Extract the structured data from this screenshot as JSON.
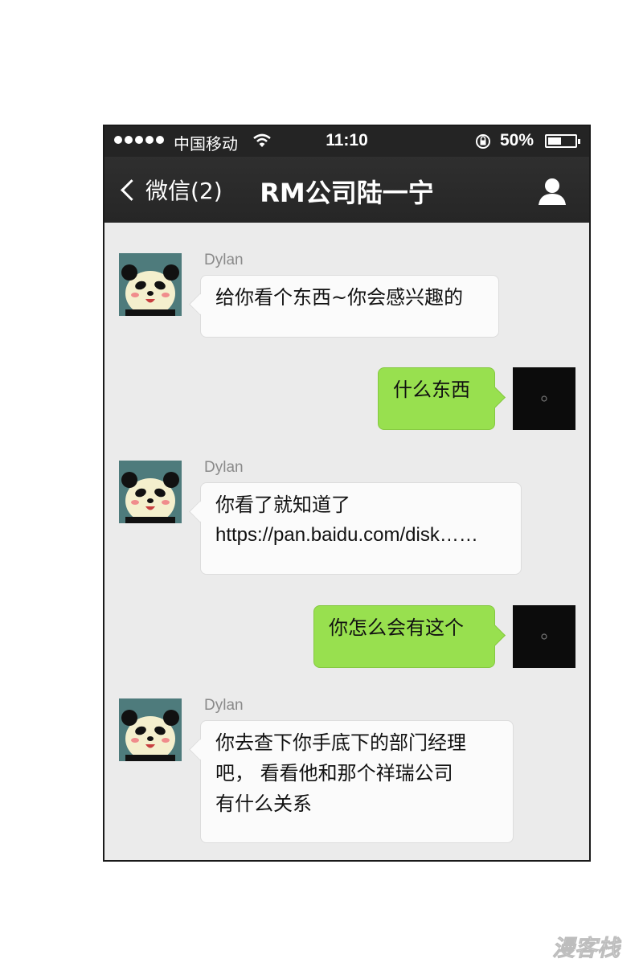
{
  "status_bar": {
    "carrier": "中国移动",
    "time": "11:10",
    "battery": "50%",
    "battery_level": 0.5
  },
  "nav": {
    "back_label": "微信(2)",
    "title": "RM公司陆一宁"
  },
  "messages": [
    {
      "side": "left",
      "sender": "Dylan",
      "lines": [
        "给你看个东西~你会感兴趣的"
      ]
    },
    {
      "side": "right",
      "lines": [
        "什么东西"
      ]
    },
    {
      "side": "left",
      "sender": "Dylan",
      "lines": [
        "你看了就知道了",
        "https://pan.baidu.com/disk……"
      ]
    },
    {
      "side": "right",
      "lines": [
        "你怎么会有这个"
      ]
    },
    {
      "side": "left",
      "sender": "Dylan",
      "lines": [
        "你去查下你手底下的部门经理",
        "吧， 看看他和那个祥瑞公司",
        "有什么关系"
      ]
    }
  ],
  "watermark": "漫客栈",
  "colors": {
    "nav_bg": "#262626",
    "chat_bg": "#ebebeb",
    "sent_bubble": "#98e04f",
    "received_bubble": "#fbfbfb"
  }
}
